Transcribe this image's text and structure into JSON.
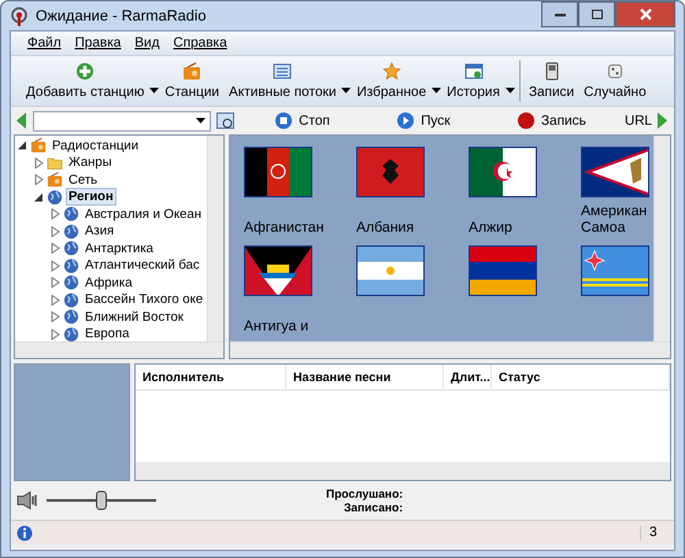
{
  "window": {
    "title": "Ожидание - RarmaRadio"
  },
  "menu": [
    "Файл",
    "Правка",
    "Вид",
    "Справка"
  ],
  "toolbar": [
    {
      "label": "Добавить станцию",
      "kind": "add",
      "dropdown": true,
      "separator": false
    },
    {
      "label": "Станции",
      "kind": "radio",
      "dropdown": false,
      "separator": false
    },
    {
      "label": "Активные потоки",
      "kind": "list",
      "dropdown": true,
      "separator": false
    },
    {
      "label": "Избранное",
      "kind": "star",
      "dropdown": true,
      "separator": false
    },
    {
      "label": "История",
      "kind": "history",
      "dropdown": true,
      "separator": false
    },
    {
      "label": "Записи",
      "kind": "player",
      "dropdown": false,
      "separator": true
    },
    {
      "label": "Случайно",
      "kind": "dice",
      "dropdown": false,
      "separator": false
    }
  ],
  "playback": [
    {
      "label": "Стоп",
      "kind": "stop"
    },
    {
      "label": "Пуск",
      "kind": "play"
    },
    {
      "label": "Запись",
      "kind": "record"
    }
  ],
  "url_label": "URL",
  "tree": [
    {
      "label": "Радиостанции",
      "kind": "radio",
      "expanded": true,
      "selected": false,
      "children": [
        {
          "label": "Жанры",
          "kind": "folder",
          "expanded": false,
          "selected": false
        },
        {
          "label": "Сеть",
          "kind": "radio",
          "expanded": false,
          "selected": false
        },
        {
          "label": "Регион",
          "kind": "globe",
          "expanded": true,
          "selected": true,
          "children": [
            {
              "label": "Австралия и Океан",
              "kind": "globe",
              "expanded": false,
              "selected": false
            },
            {
              "label": "Азия",
              "kind": "globe",
              "expanded": false,
              "selected": false
            },
            {
              "label": "Антарктика",
              "kind": "globe",
              "expanded": false,
              "selected": false
            },
            {
              "label": "Атлантический бас",
              "kind": "globe",
              "expanded": false,
              "selected": false
            },
            {
              "label": "Африка",
              "kind": "globe",
              "expanded": false,
              "selected": false
            },
            {
              "label": "Бассейн Тихого оке",
              "kind": "globe",
              "expanded": false,
              "selected": false
            },
            {
              "label": "Ближний Восток",
              "kind": "globe",
              "expanded": false,
              "selected": false
            },
            {
              "label": "Европа",
              "kind": "globe",
              "expanded": false,
              "selected": false
            }
          ]
        }
      ]
    }
  ],
  "countries": [
    {
      "name": "Афганистан",
      "kind": "afghanistan"
    },
    {
      "name": "Албания",
      "kind": "albania"
    },
    {
      "name": "Алжир",
      "kind": "algeria"
    },
    {
      "name": "Американ Самоа",
      "kind": "samoa"
    },
    {
      "name": "Антигуа и",
      "kind": "antigua"
    },
    {
      "kind": "argentina"
    },
    {
      "kind": "armenia"
    },
    {
      "kind": "aruba"
    }
  ],
  "table": {
    "columns": [
      "Исполнитель",
      "Название песни",
      "Длит...",
      "Статус"
    ]
  },
  "volume": {
    "level": 0.5
  },
  "info": [
    {
      "label": "Прослушано:"
    },
    {
      "label": "Записано:"
    }
  ],
  "status_bar": {
    "count": "3"
  }
}
